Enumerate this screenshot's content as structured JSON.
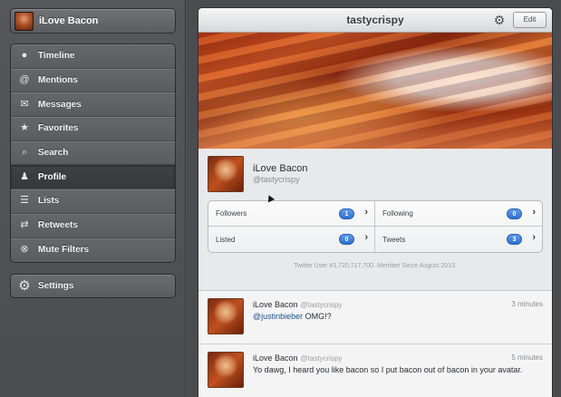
{
  "account": {
    "name": "iLove Bacon"
  },
  "sidebar": {
    "items": [
      {
        "label": "Timeline",
        "icon": "timeline-icon",
        "glyph": "●",
        "active": false
      },
      {
        "label": "Mentions",
        "icon": "at-icon",
        "glyph": "@",
        "active": false
      },
      {
        "label": "Messages",
        "icon": "envelope-icon",
        "glyph": "✉",
        "active": false
      },
      {
        "label": "Favorites",
        "icon": "star-icon",
        "glyph": "★",
        "active": false
      },
      {
        "label": "Search",
        "icon": "search-icon",
        "glyph": "⌕",
        "active": false
      },
      {
        "label": "Profile",
        "icon": "person-icon",
        "glyph": "♟",
        "active": true
      },
      {
        "label": "Lists",
        "icon": "list-icon",
        "glyph": "☰",
        "active": false
      },
      {
        "label": "Retweets",
        "icon": "retweet-icon",
        "glyph": "⇄",
        "active": false
      },
      {
        "label": "Mute Filters",
        "icon": "mute-icon",
        "glyph": "⊗",
        "active": false
      }
    ],
    "settings_label": "Settings"
  },
  "header": {
    "title": "tastycrispy",
    "edit_label": "Edit"
  },
  "profile": {
    "name": "iLove Bacon",
    "handle": "@tastycrispy",
    "stats": [
      {
        "label": "Followers",
        "count": "1"
      },
      {
        "label": "Following",
        "count": "0"
      },
      {
        "label": "Listed",
        "count": "0"
      },
      {
        "label": "Tweets",
        "count": "3"
      }
    ],
    "member_since": "Twitter User #1,720,717,700. Member Since August 2013."
  },
  "tweets": [
    {
      "name": "iLove Bacon",
      "handle": "@tastycrispy",
      "time": "3 minutes",
      "mention": "@justinbieber",
      "text": " OMG!?"
    },
    {
      "name": "iLove Bacon",
      "handle": "@tastycrispy",
      "time": "5 minutes",
      "mention": "",
      "text": "Yo dawg, I heard you like bacon so I put bacon out of bacon in your avatar."
    }
  ],
  "colors": {
    "accent_badge": "#2e6fd0",
    "sidebar_bg": "#4b4d51",
    "panel_bg": "#f4f4f5"
  }
}
